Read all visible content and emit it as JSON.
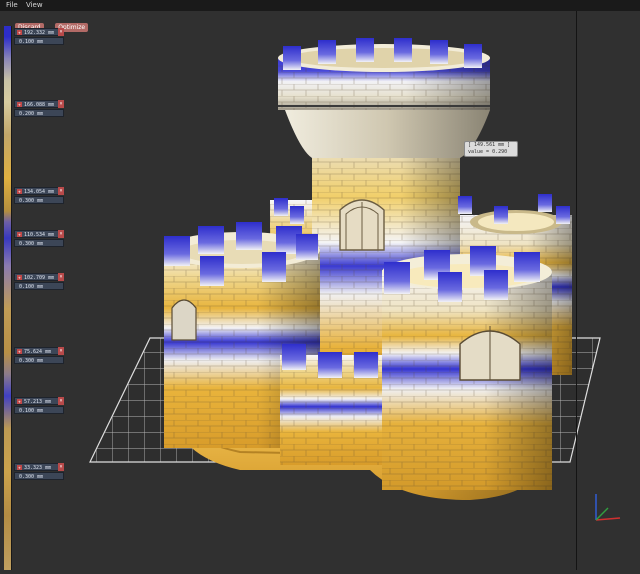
{
  "menu": {
    "file": "File",
    "view": "View"
  },
  "toolbar": {
    "discard": "Discard",
    "optimize": "Optimize"
  },
  "controls": [
    {
      "value": "192.332 mm",
      "sub": "0.100",
      "unit": "mm"
    },
    {
      "value": "166.088 mm",
      "sub": "0.200",
      "unit": "mm"
    },
    {
      "value": "134.054 mm",
      "sub": "0.300",
      "unit": "mm"
    },
    {
      "value": "110.534 mm",
      "sub": "0.300",
      "unit": "mm"
    },
    {
      "value": "102.709 mm",
      "sub": "0.100",
      "unit": "mm"
    },
    {
      "value": "75.624 mm",
      "sub": "0.300",
      "unit": "mm"
    },
    {
      "value": "57.213 mm",
      "sub": "0.100",
      "unit": "mm"
    },
    {
      "value": "33.323 mm",
      "sub": "0.300",
      "unit": "mm"
    }
  ],
  "tooltip": {
    "line1": "[ 149.561 mm ]",
    "line2": "value = 0.290 mm"
  },
  "colors": {
    "blue": "#3434d0",
    "gold": "#e8b13a",
    "background": "#303030",
    "grid": "#c8c8c8"
  }
}
